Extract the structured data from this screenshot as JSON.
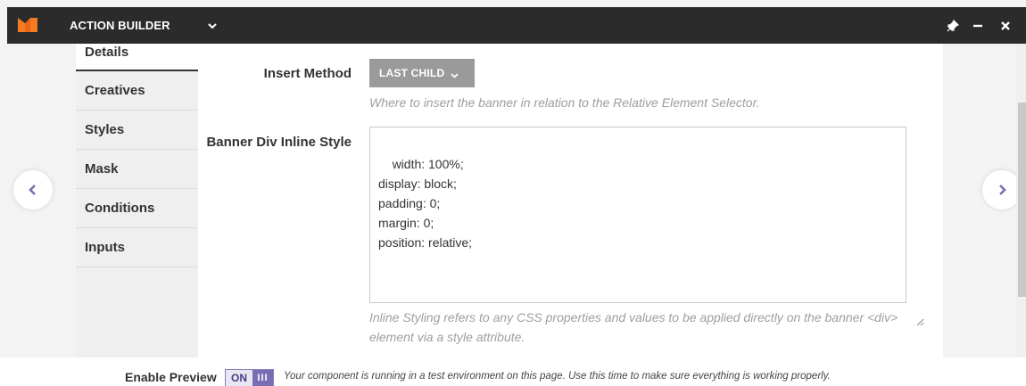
{
  "header": {
    "title": "ACTION BUILDER",
    "logo_colors": [
      "#f47b20",
      "#7b5ea7"
    ],
    "icons": [
      "logo-icon",
      "chevron-down-icon",
      "pin-icon",
      "minimize-icon",
      "close-icon"
    ]
  },
  "sidebar": {
    "items": [
      {
        "label": "Details",
        "active": true
      },
      {
        "label": "Creatives"
      },
      {
        "label": "Styles"
      },
      {
        "label": "Mask"
      },
      {
        "label": "Conditions"
      },
      {
        "label": "Inputs"
      }
    ]
  },
  "form": {
    "insert_method": {
      "label": "Insert Method",
      "value": "LAST CHILD",
      "help": "Where to insert the banner in relation to the Relative Element Selector."
    },
    "banner_style": {
      "label": "Banner Div Inline Style",
      "value": "width: 100%;\ndisplay: block;\npadding: 0;\nmargin: 0;\nposition: relative;",
      "help_line1": "Inline Styling refers to any CSS properties and values to be applied directly on the banner <div>",
      "help_line2": "element via a style attribute."
    }
  },
  "navigation": {
    "prev_icon": "chevron-left-icon",
    "next_icon": "chevron-right-icon",
    "accent": "#7b6fb0"
  },
  "footer": {
    "label": "Enable Preview",
    "toggle_on": "ON",
    "toggle_handle": "III",
    "note": "Your component is running in a test environment on this page. Use this time to make sure everything is working properly."
  }
}
